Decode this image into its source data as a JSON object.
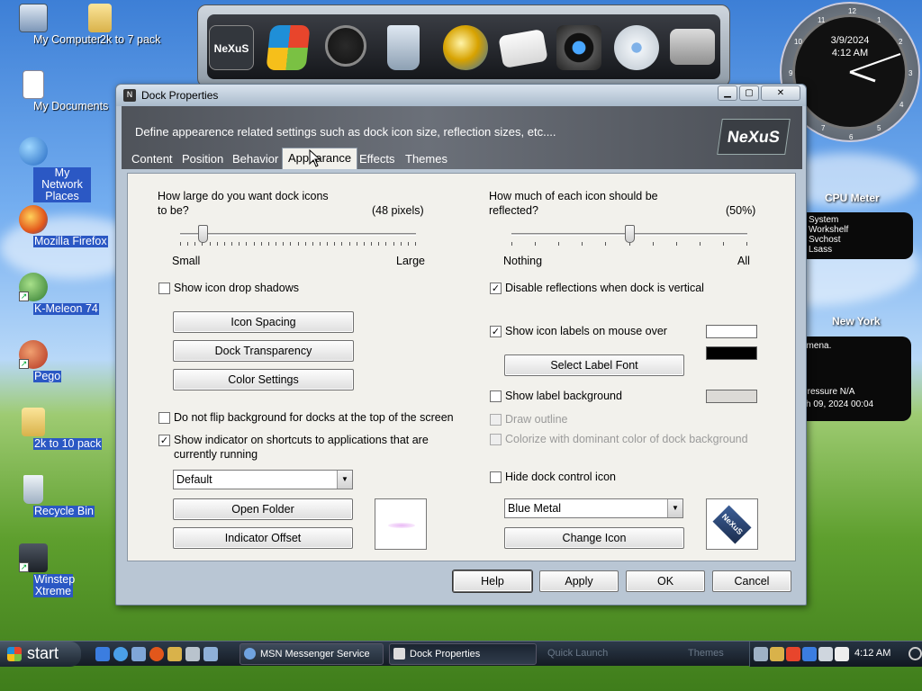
{
  "desktop": {
    "icons": [
      {
        "label": "My Computer"
      },
      {
        "label": "2k to 7 pack"
      },
      {
        "label": "My Documents"
      },
      {
        "label": "My Network Places"
      },
      {
        "label": "Mozilla Firefox"
      },
      {
        "label": "K-Meleon 74"
      },
      {
        "label": "Pego"
      },
      {
        "label": "2k to 10 pack"
      },
      {
        "label": "Recycle Bin"
      },
      {
        "label": "Winstep Xtreme"
      }
    ]
  },
  "dock": {
    "items": [
      "nexus-logo-icon",
      "windows-logo-icon",
      "clock-icon",
      "recycle-bin-icon",
      "internet-globe-icon",
      "mail-icon",
      "camera-icon",
      "disk-icon",
      "toolbox-icon"
    ],
    "logo_text": "NeXuS"
  },
  "clock_gadget": {
    "date": "3/9/2024",
    "time": "4:12 AM",
    "numbers": [
      "12",
      "1",
      "2",
      "3",
      "4",
      "5",
      "6",
      "7",
      "8",
      "9",
      "10",
      "11"
    ]
  },
  "cpu_meter": {
    "title": "CPU Meter",
    "lines": [
      "System",
      "Workshelf",
      "Svchost",
      "Lsass"
    ]
  },
  "weather": {
    "title": "New York",
    "line1": "omena.",
    "line2": "Pressure N/A",
    "line3": "ch 09, 2024 00:04"
  },
  "window": {
    "title": "Dock Properties",
    "banner_text": "Define appearence related settings such as dock icon size, reflection sizes, etc....",
    "banner_logo": "NeXuS",
    "tabs": [
      {
        "label": "Content",
        "active": false
      },
      {
        "label": "Position",
        "active": false
      },
      {
        "label": "Behavior",
        "active": false
      },
      {
        "label": "Appearance",
        "active": true
      },
      {
        "label": "Effects",
        "active": false
      },
      {
        "label": "Themes",
        "active": false
      }
    ],
    "left": {
      "icon_size_q1": "How large do you want dock icons",
      "icon_size_q2": "to be?",
      "icon_size_value": "(48 pixels)",
      "icon_size_fraction": 0.08,
      "slider_min": "Small",
      "slider_max": "Large",
      "drop_shadows": {
        "label": "Show icon drop shadows",
        "checked": false
      },
      "btn_icon_spacing": "Icon Spacing",
      "btn_dock_transparency": "Dock Transparency",
      "btn_color_settings": "Color Settings",
      "no_flip": {
        "label": "Do not flip background for docks at the top of the screen",
        "checked": false
      },
      "indicator_line1": "Show indicator on shortcuts to applications that are",
      "indicator_line2": "currently running",
      "indicator_checked": true,
      "indicator_select": "Default",
      "btn_open_folder": "Open Folder",
      "btn_indicator_offset": "Indicator Offset"
    },
    "right": {
      "reflect_q1": "How much of each icon should be",
      "reflect_q2": "reflected?",
      "reflect_value": "(50%)",
      "reflect_fraction": 0.5,
      "slider_min": "Nothing",
      "slider_max": "All",
      "disable_reflections": {
        "label": "Disable reflections when dock is vertical",
        "checked": true
      },
      "show_labels": {
        "label": "Show icon labels on mouse over",
        "checked": true
      },
      "btn_select_label_font": "Select Label Font",
      "label_bg": {
        "label": "Show label background",
        "checked": false
      },
      "draw_outline": {
        "label": "Draw outline",
        "checked": false
      },
      "colorize": {
        "label": "Colorize with dominant color of dock background",
        "checked": false
      },
      "hide_control": {
        "label": "Hide dock control icon",
        "checked": false
      },
      "control_select": "Blue Metal",
      "btn_change_icon": "Change Icon",
      "preview_logo": "NeXuS",
      "swatch_colors": [
        "#ffffff",
        "#000000",
        "#dcdad6"
      ]
    },
    "footer": {
      "help": "Help",
      "apply": "Apply",
      "ok": "OK",
      "cancel": "Cancel"
    }
  },
  "taskbar": {
    "start_label": "start",
    "tasks": [
      {
        "label": "MSN Messenger Service",
        "active": false
      },
      {
        "label": "Dock Properties",
        "active": true
      }
    ],
    "quick_launch_label": "Quick Launch",
    "themes_label": "Themes",
    "time": "4:12 AM"
  }
}
